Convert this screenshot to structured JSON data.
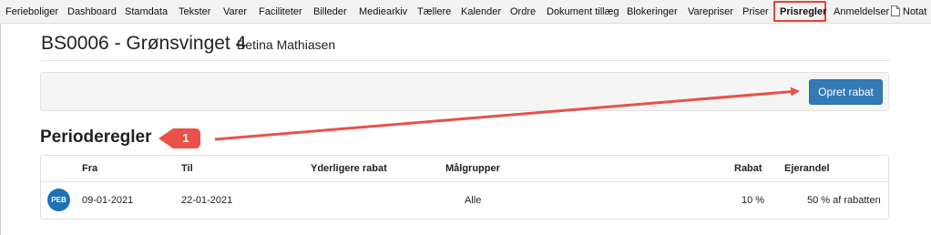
{
  "nav": {
    "items": [
      "Ferieboliger",
      "Dashboard",
      "Stamdata",
      "Tekster",
      "Varer",
      "Faciliteter",
      "Billeder",
      "Mediearkiv",
      "Tællere",
      "Kalender",
      "Ordre",
      "Dokument tillæg",
      "Blokeringer",
      "Varepriser",
      "Priser",
      "Prisregler",
      "Anmeldelser",
      "Notat"
    ],
    "active": "Prisregler"
  },
  "header": {
    "title": "BS0006 - Grønsvinget 4",
    "person": "Betina Mathiasen"
  },
  "actions": {
    "create_label": "Opret rabat"
  },
  "section": {
    "title": "Perioderegler"
  },
  "table": {
    "columns": [
      "Fra",
      "Til",
      "Yderligere rabat",
      "Målgrupper",
      "Rabat",
      "Ejerandel"
    ],
    "rows": [
      {
        "badge": "PEB",
        "fra": "09-01-2021",
        "til": "22-01-2021",
        "yderligere_rabat": "",
        "maalgrupper": "Alle",
        "rabat": "10 %",
        "ejerandel": "50 % af rabatten"
      }
    ]
  },
  "annotation": {
    "number": "1",
    "color": "#e8524a"
  },
  "colors": {
    "primary": "#337ab7",
    "avatar": "#1f72b8",
    "highlight": "#e0463b"
  }
}
